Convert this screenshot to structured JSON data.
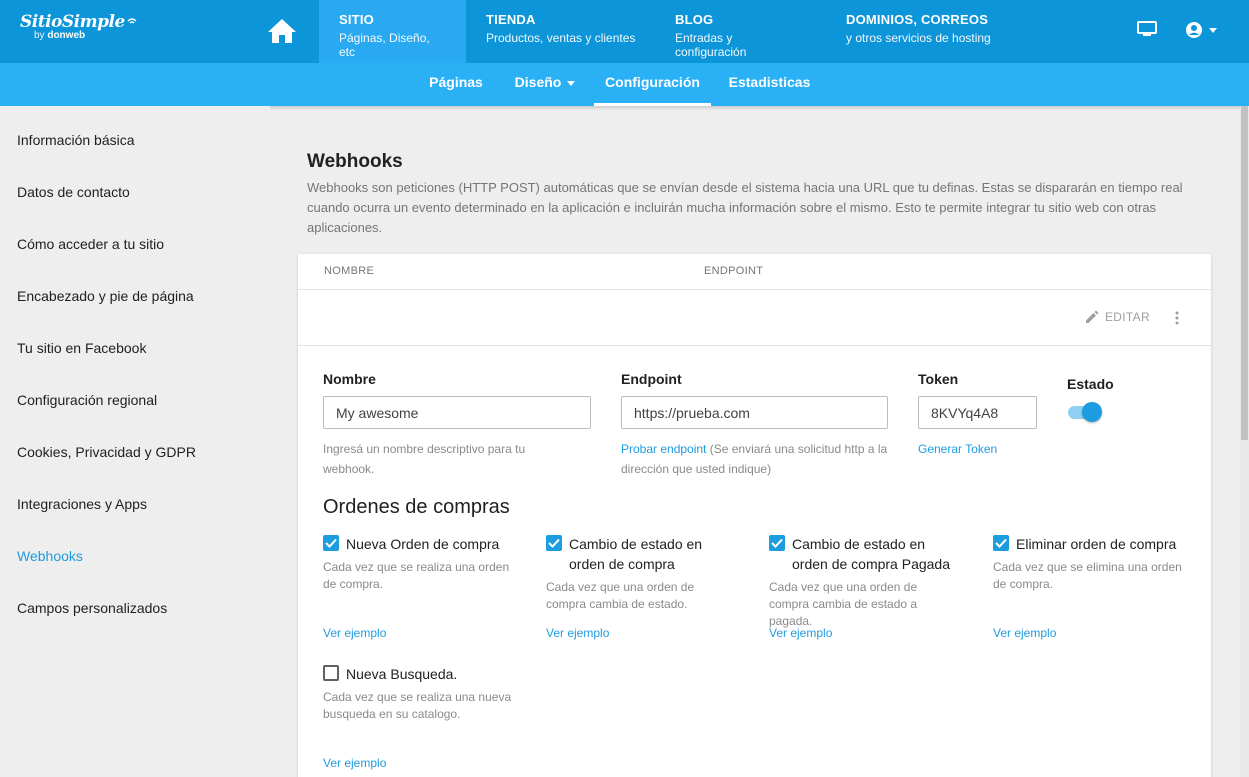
{
  "brand": {
    "name": "SitioSimple",
    "by": "by",
    "company": "donweb"
  },
  "topnav": [
    {
      "title": "SITIO",
      "sub": "Páginas, Diseño, etc",
      "active": true
    },
    {
      "title": "TIENDA",
      "sub": "Productos, ventas y clientes"
    },
    {
      "title": "BLOG",
      "sub": "Entradas y configuración"
    },
    {
      "title": "DOMINIOS, CORREOS",
      "sub": "y otros servicios de hosting"
    }
  ],
  "subnav": {
    "paginas": "Páginas",
    "diseno": "Diseño",
    "configuracion": "Configuración",
    "estadisticas": "Estadisticas",
    "active": "Configuración"
  },
  "sidebar": {
    "items": [
      {
        "label": "Información básica"
      },
      {
        "label": "Datos de contacto"
      },
      {
        "label": "Cómo acceder a tu sitio"
      },
      {
        "label": "Encabezado y pie de página"
      },
      {
        "label": "Tu sitio en Facebook"
      },
      {
        "label": "Configuración regional"
      },
      {
        "label": "Cookies, Privacidad y GDPR"
      },
      {
        "label": "Integraciones y Apps"
      },
      {
        "label": "Webhooks",
        "active": true
      },
      {
        "label": "Campos personalizados"
      }
    ]
  },
  "main": {
    "title": "Webhooks",
    "description": "Webhooks son peticiones (HTTP POST) automáticas que se envían desde el sistema hacia una URL que tu definas. Estas se dispararán en tiempo real cuando ocurra un evento determinado en la aplicación e incluirán mucha información sobre el mismo. Esto te permite integrar tu sitio web con otras aplicaciones."
  },
  "table": {
    "col_name": "NOMBRE",
    "col_endpoint": "ENDPOINT",
    "edit_label": "EDITAR"
  },
  "form": {
    "name_label": "Nombre",
    "name_value": "My awesome",
    "name_help": "Ingresá un nombre descriptivo para tu webhook.",
    "endpoint_label": "Endpoint",
    "endpoint_value": "https://prueba.com",
    "endpoint_test_link": "Probar endpoint",
    "endpoint_help": " (Se enviará una solicitud http a la dirección que usted indique)",
    "token_label": "Token",
    "token_value": "8KVYq4A8",
    "token_generate_link": "Generar Token",
    "status_label": "Estado",
    "status_on": true
  },
  "orders": {
    "section_title": "Ordenes de compras",
    "example_link": "Ver ejemplo",
    "events": [
      {
        "label": "Nueva Orden de compra",
        "desc": "Cada vez que se realiza una orden de compra.",
        "checked": true
      },
      {
        "label": "Cambio de estado en orden de compra",
        "desc": "Cada vez que una orden de compra cambia de estado.",
        "checked": true
      },
      {
        "label": "Cambio de estado en orden de compra Pagada",
        "desc": "Cada vez que una orden de compra cambia de estado a pagada.",
        "checked": true
      },
      {
        "label": "Eliminar orden de compra",
        "desc": "Cada vez que se elimina una orden de compra.",
        "checked": true
      },
      {
        "label": "Nueva Busqueda.",
        "desc": "Cada vez que se realiza una nueva busqueda en su catalogo.",
        "checked": false
      }
    ]
  },
  "colors": {
    "topbar": "#0c95d8",
    "topnav_active": "#29a9f1",
    "subnav": "#2ab0f5",
    "accent": "#1e9ce0"
  },
  "icons": {
    "home": "home-icon",
    "monitor": "monitor-icon",
    "account": "account-circle-icon",
    "edit": "pencil-icon",
    "more": "more-vert-icon",
    "check": "check-icon"
  }
}
